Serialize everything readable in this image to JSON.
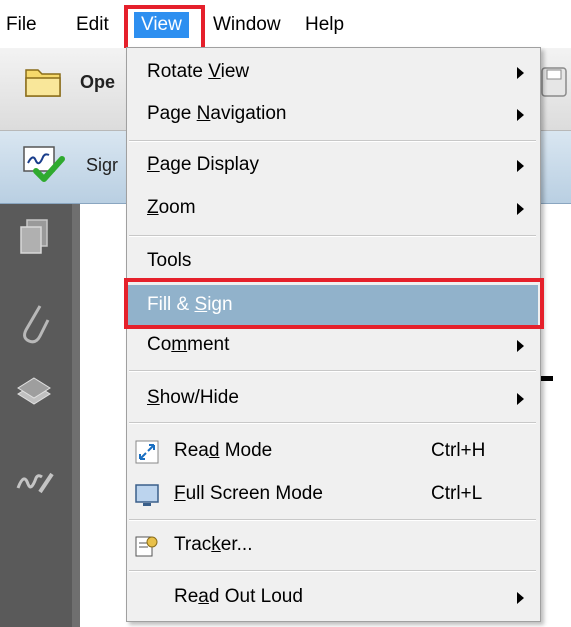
{
  "menubar": {
    "file": "File",
    "edit": "Edit",
    "view": "View",
    "window": "Window",
    "help": "Help"
  },
  "toolbar": {
    "open_label": "Ope",
    "sign_label": "Sigr"
  },
  "view_menu": {
    "items": [
      {
        "pre": "Rotate ",
        "u": "V",
        "post": "iew",
        "submenu": true
      },
      {
        "pre": "Page ",
        "u": "N",
        "post": "avigation",
        "submenu": true
      },
      {
        "pre": "",
        "u": "P",
        "post": "age Display",
        "submenu": true
      },
      {
        "pre": "",
        "u": "Z",
        "post": "oom",
        "submenu": true
      },
      {
        "pre": "Tools",
        "u": "",
        "post": "",
        "submenu": false
      },
      {
        "pre": "Fill & ",
        "u": "S",
        "post": "ign",
        "submenu": false,
        "selected": true
      },
      {
        "pre": "Co",
        "u": "m",
        "post": "ment",
        "submenu": true
      },
      {
        "pre": "",
        "u": "S",
        "post": "how/Hide",
        "submenu": true
      },
      {
        "pre": "Rea",
        "u": "d",
        "post": " Mode",
        "shortcut": "Ctrl+H",
        "icon": "read-mode-icon"
      },
      {
        "pre": "",
        "u": "F",
        "post": "ull Screen Mode",
        "shortcut": "Ctrl+L",
        "icon": "full-screen-icon"
      },
      {
        "pre": "Trac",
        "u": "k",
        "post": "er...",
        "icon": "tracker-icon"
      },
      {
        "pre": "Re",
        "u": "a",
        "post": "d Out Loud",
        "submenu": true
      }
    ]
  },
  "colors": {
    "highlight_red": "#e5202b",
    "selected_bg": "#91b2cb",
    "menu_active": "#2d8ff0"
  }
}
